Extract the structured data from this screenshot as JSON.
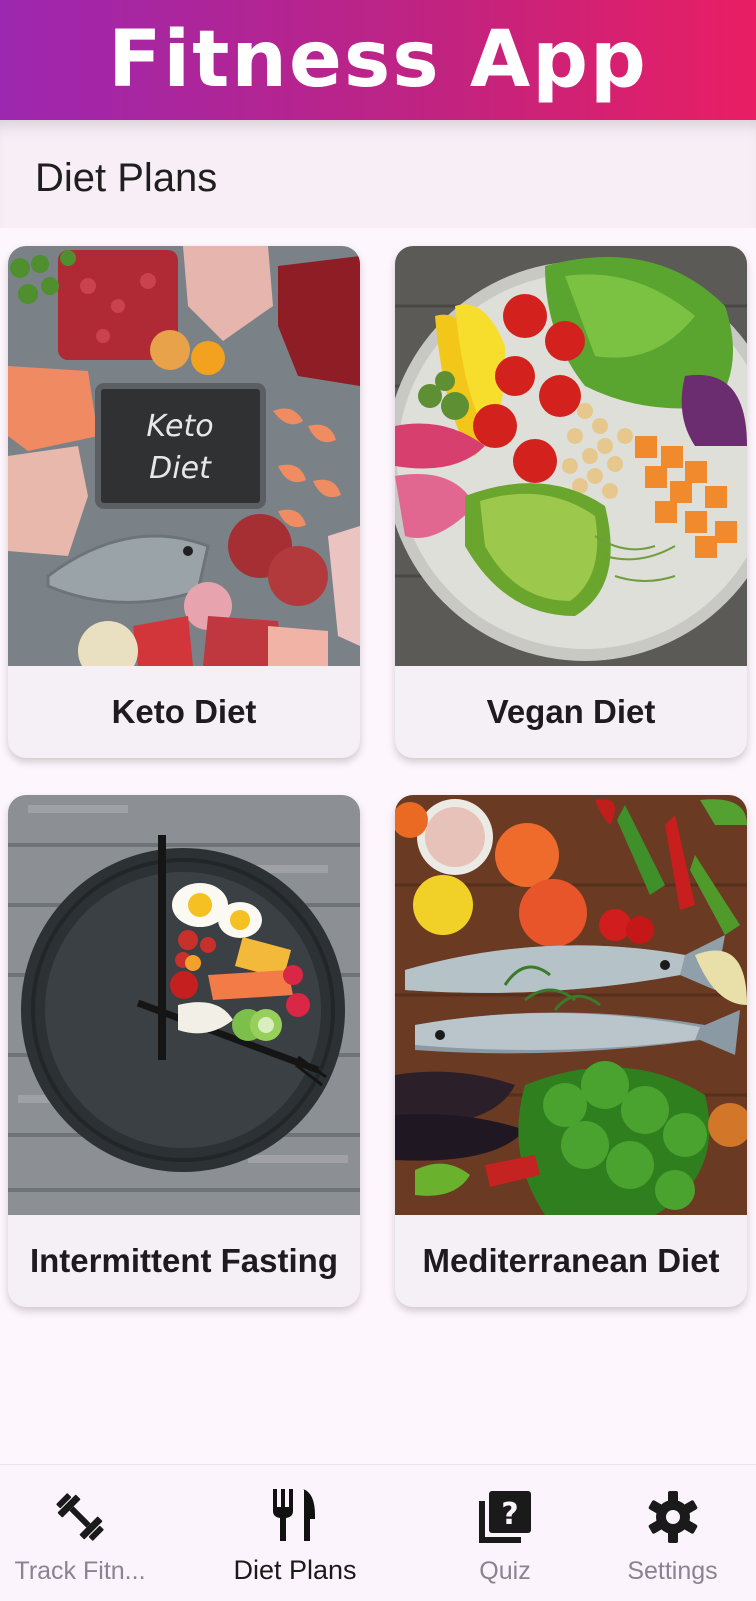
{
  "app": {
    "title": "Fitness App"
  },
  "page": {
    "title": "Diet Plans"
  },
  "diet_plans": [
    {
      "label": "Keto Diet",
      "image": "keto-foods-photo"
    },
    {
      "label": "Vegan Diet",
      "image": "vegan-bowl-photo"
    },
    {
      "label": "Intermittent Fasting",
      "image": "clock-plate-photo"
    },
    {
      "label": "Mediterranean Diet",
      "image": "fish-vegetables-photo"
    }
  ],
  "bottom_nav": {
    "items": [
      {
        "label": "Track Fitn...",
        "icon": "dumbbell-icon",
        "active": false
      },
      {
        "label": "Diet Plans",
        "icon": "fork-knife-icon",
        "active": true
      },
      {
        "label": "Quiz",
        "icon": "quiz-icon",
        "active": false
      },
      {
        "label": "Settings",
        "icon": "gear-icon",
        "active": false
      }
    ]
  },
  "colors": {
    "header_gradient_start": "#9c27b0",
    "header_gradient_end": "#e91e63",
    "background": "#fdf6fc",
    "card_background": "#f5f0f5",
    "nav_inactive": "#8a8490",
    "nav_active": "#1a1a1a"
  }
}
